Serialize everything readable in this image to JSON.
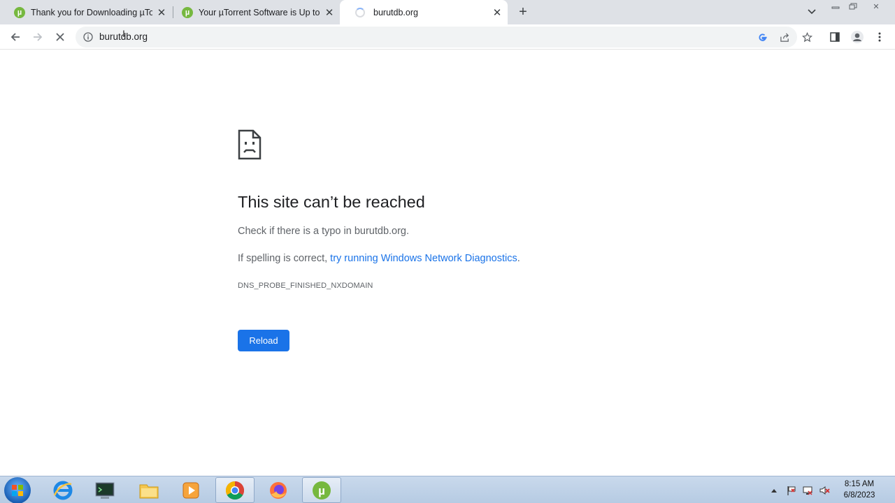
{
  "browser": {
    "tabs": [
      {
        "title": "Thank you for Downloading µTorrent",
        "favicon": "utorrent-icon",
        "active": false
      },
      {
        "title": "Your µTorrent Software is Up to Date",
        "favicon": "utorrent-icon",
        "active": false
      },
      {
        "title": "burutdb.org",
        "favicon": "loading-spinner",
        "active": true
      }
    ],
    "url": "burutdb.org"
  },
  "error_page": {
    "title": "This site can’t be reached",
    "line1": "Check if there is a typo in burutdb.org.",
    "line2_prefix": "If spelling is correct, ",
    "line2_link": "try running Windows Network Diagnostics",
    "line2_suffix": ".",
    "error_code": "DNS_PROBE_FINISHED_NXDOMAIN",
    "reload_label": "Reload"
  },
  "taskbar": {
    "pinned": [
      "internet-explorer-icon",
      "terminal-icon",
      "file-explorer-icon",
      "media-player-icon",
      "chrome-icon",
      "firefox-icon",
      "utorrent-icon"
    ],
    "clock_time": "8:15 AM",
    "clock_date": "6/8/2023"
  },
  "colors": {
    "tab_strip": "#dee1e6",
    "link": "#1a73e8",
    "button": "#1a73e8",
    "utorrent_green": "#76b83f"
  }
}
